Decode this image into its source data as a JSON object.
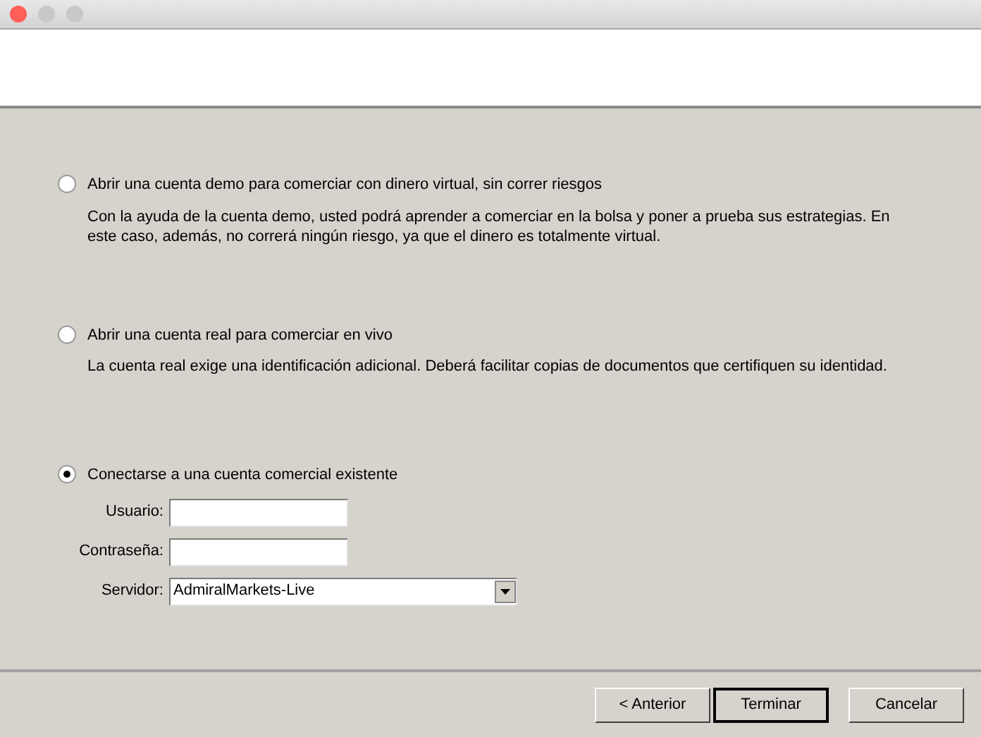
{
  "window": {
    "controls": [
      {
        "color": "#fe5f57"
      },
      {
        "color": "#c8c8c8"
      },
      {
        "color": "#c8c8c8"
      }
    ]
  },
  "options": [
    {
      "label": "Abrir una cuenta demo para comerciar con dinero virtual, sin correr riesgos",
      "description": "Con la ayuda de la cuenta demo, usted podrá aprender a comerciar en la bolsa y poner a prueba sus estrategias. En este caso, además, no correrá ningún riesgo, ya que el dinero es totalmente virtual.",
      "selected": false
    },
    {
      "label": "Abrir una cuenta real para comerciar en vivo",
      "description": "La cuenta real exige una identificación adicional. Deberá facilitar copias de documentos que certifiquen su identidad.",
      "selected": false
    },
    {
      "label": "Conectarse a una cuenta comercial existente",
      "selected": true
    }
  ],
  "login_fields": [
    {
      "kind": "text",
      "label": "Usuario:"
    },
    {
      "kind": "text",
      "label": "Contraseña:"
    },
    {
      "kind": "dropdown",
      "label": "Servidor:",
      "value": "AdmiralMarkets-Live"
    }
  ],
  "buttons": [
    {
      "label": "< Anterior",
      "default": false
    },
    {
      "label": "Terminar",
      "default": true
    },
    {
      "label": "Cancelar",
      "default": false
    }
  ]
}
